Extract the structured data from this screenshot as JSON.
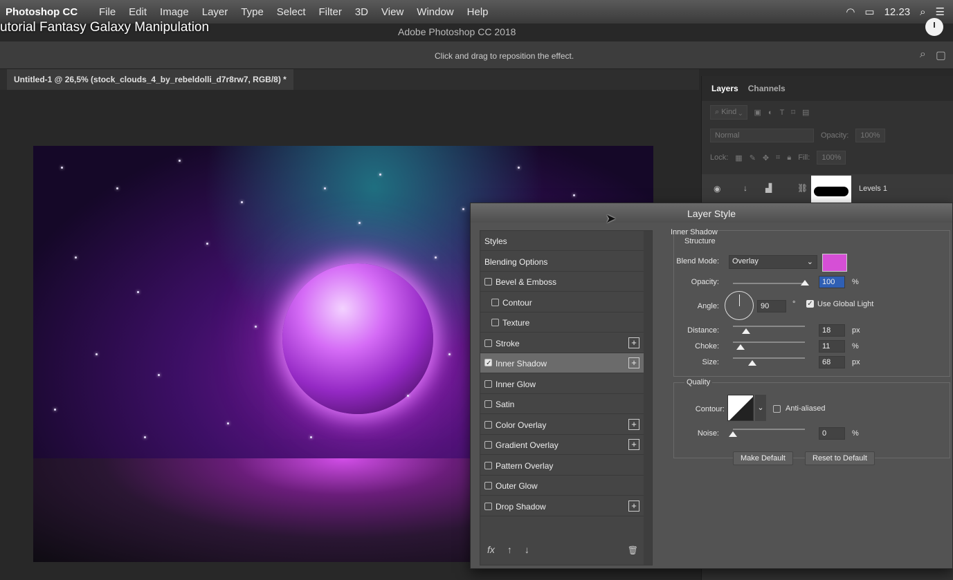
{
  "menubar": {
    "app": "Photoshop CC",
    "items": [
      "File",
      "Edit",
      "Image",
      "Layer",
      "Type",
      "Select",
      "Filter",
      "3D",
      "View",
      "Window",
      "Help"
    ],
    "time": "12.23"
  },
  "video_title": "utorial Fantasy Galaxy Manipulation",
  "window_title": "Adobe Photoshop CC 2018",
  "options_bar": {
    "hint": "Click and drag to reposition the effect."
  },
  "document_tab": "Untitled-1 @ 26,5% (stock_clouds_4_by_rebeldolli_d7r8rw7, RGB/8) *",
  "layers_panel": {
    "tabs": [
      "Layers",
      "Channels"
    ],
    "filter": "Kind",
    "blend": "Normal",
    "opacity_label": "Opacity:",
    "opacity_value": "100%",
    "lock_label": "Lock:",
    "fill_label": "Fill:",
    "fill_value": "100%",
    "layer_name": "Levels 1"
  },
  "dialog": {
    "title": "Layer Style",
    "styles": [
      {
        "label": "Styles",
        "checkbox": false,
        "plus": false
      },
      {
        "label": "Blending Options",
        "checkbox": false,
        "plus": false
      },
      {
        "label": "Bevel & Emboss",
        "checkbox": true,
        "checked": false,
        "plus": false
      },
      {
        "label": "Contour",
        "checkbox": true,
        "checked": false,
        "plus": false,
        "indent": true
      },
      {
        "label": "Texture",
        "checkbox": true,
        "checked": false,
        "plus": false,
        "indent": true
      },
      {
        "label": "Stroke",
        "checkbox": true,
        "checked": false,
        "plus": true
      },
      {
        "label": "Inner Shadow",
        "checkbox": true,
        "checked": true,
        "plus": true,
        "selected": true
      },
      {
        "label": "Inner Glow",
        "checkbox": true,
        "checked": false,
        "plus": false
      },
      {
        "label": "Satin",
        "checkbox": true,
        "checked": false,
        "plus": false
      },
      {
        "label": "Color Overlay",
        "checkbox": true,
        "checked": false,
        "plus": true
      },
      {
        "label": "Gradient Overlay",
        "checkbox": true,
        "checked": false,
        "plus": true
      },
      {
        "label": "Pattern Overlay",
        "checkbox": true,
        "checked": false,
        "plus": false
      },
      {
        "label": "Outer Glow",
        "checkbox": true,
        "checked": false,
        "plus": false
      },
      {
        "label": "Drop Shadow",
        "checkbox": true,
        "checked": false,
        "plus": true
      }
    ],
    "footer_fx": "fx",
    "section_title": "Inner Shadow",
    "structure_title": "Structure",
    "blend_mode_label": "Blend Mode:",
    "blend_mode_value": "Overlay",
    "shadow_color": "#d64fd6",
    "opacity_label": "Opacity:",
    "opacity_value": "100",
    "opacity_level": 1.0,
    "angle_label": "Angle:",
    "angle_value": "90",
    "use_global_light": "Use Global Light",
    "distance_label": "Distance:",
    "distance_value": "18",
    "distance_level": 0.18,
    "choke_label": "Choke:",
    "choke_value": "11",
    "choke_level": 0.11,
    "size_label": "Size:",
    "size_value": "68",
    "size_level": 0.27,
    "unit_px": "px",
    "unit_pct": "%",
    "degree": "°",
    "quality_title": "Quality",
    "contour_label": "Contour:",
    "anti_aliased": "Anti-aliased",
    "noise_label": "Noise:",
    "noise_value": "0",
    "noise_level": 0.0,
    "make_default": "Make Default",
    "reset_default": "Reset to Default"
  }
}
